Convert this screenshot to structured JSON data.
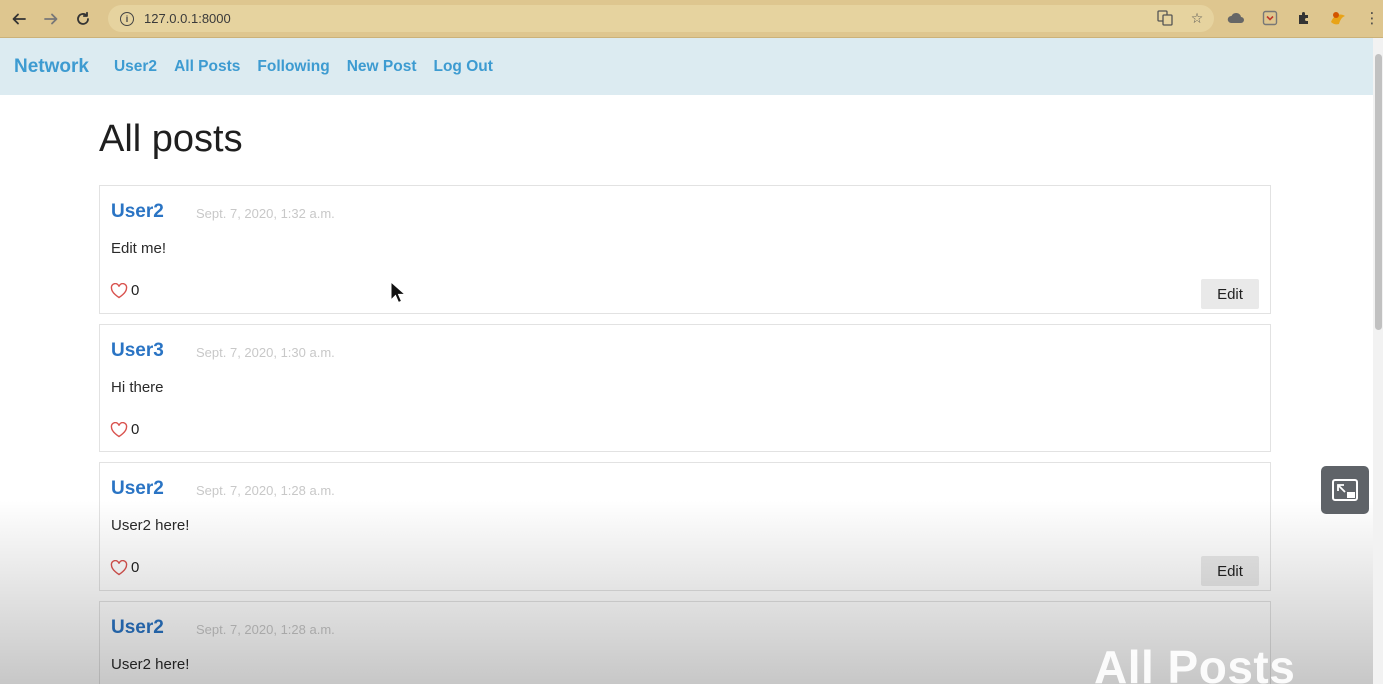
{
  "browser": {
    "url": "127.0.0.1:8000"
  },
  "navbar": {
    "brand": "Network",
    "links": [
      "User2",
      "All Posts",
      "Following",
      "New Post",
      "Log Out"
    ]
  },
  "page": {
    "title": "All posts",
    "watermark": "All Posts"
  },
  "posts": [
    {
      "author": "User2",
      "timestamp": "Sept. 7, 2020, 1:32 a.m.",
      "body": "Edit me!",
      "likes": "0",
      "edit_label": "Edit"
    },
    {
      "author": "User3",
      "timestamp": "Sept. 7, 2020, 1:30 a.m.",
      "body": "Hi there",
      "likes": "0"
    },
    {
      "author": "User2",
      "timestamp": "Sept. 7, 2020, 1:28 a.m.",
      "body": "User2 here!",
      "likes": "0",
      "edit_label": "Edit"
    },
    {
      "author": "User2",
      "timestamp": "Sept. 7, 2020, 1:28 a.m.",
      "body": "User2 here!"
    }
  ],
  "colors": {
    "chrome": "#dec68f",
    "navbar_bg": "#dcebf1",
    "link": "#3d9bd1",
    "author": "#2a74c4",
    "heart": "#d9534f"
  }
}
